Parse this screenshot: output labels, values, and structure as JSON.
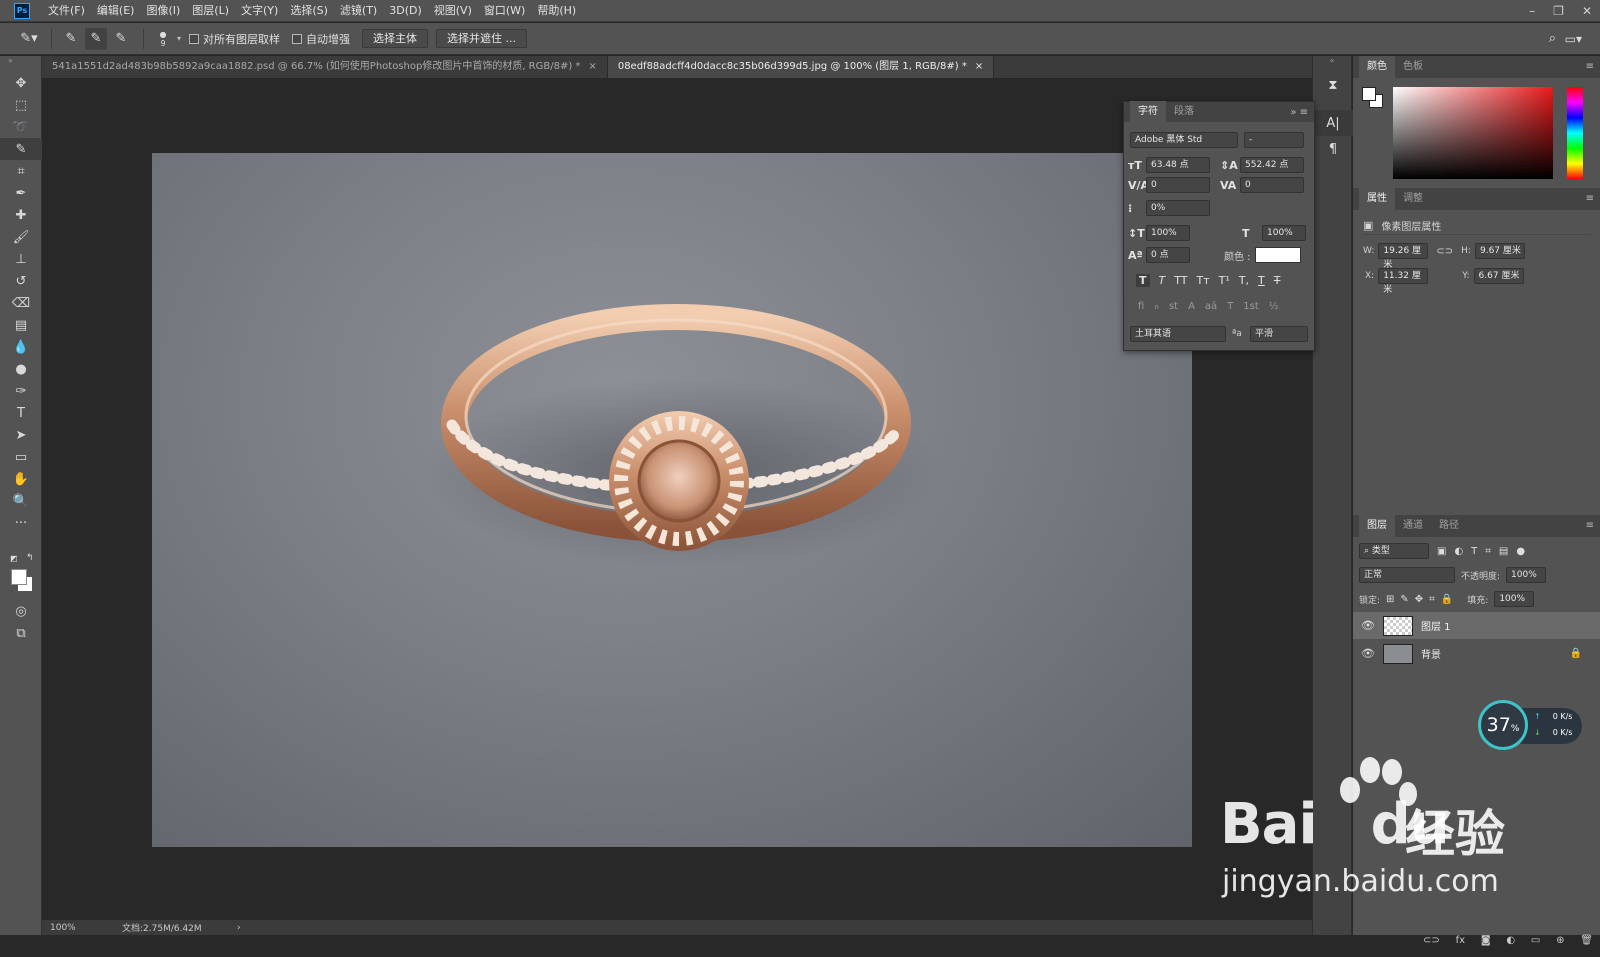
{
  "app": {
    "logo": "Ps",
    "menu": [
      "文件(F)",
      "编辑(E)",
      "图像(I)",
      "图层(L)",
      "文字(Y)",
      "选择(S)",
      "滤镜(T)",
      "3D(D)",
      "视图(V)",
      "窗口(W)",
      "帮助(H)"
    ]
  },
  "options": {
    "brush_size": "9",
    "sample_all_layers": "对所有图层取样",
    "auto_enhance": "自动增强",
    "select_subject": "选择主体",
    "select_and_mask": "选择并遮住 ..."
  },
  "tabs": [
    {
      "label": "541a1551d2ad483b98b5892a9caa1882.psd @ 66.7% (如何使用Photoshop修改图片中首饰的材质, RGB/8#) *",
      "close": "×"
    },
    {
      "label": "08edf88adcff4d0dacc8c35b06d399d5.jpg @ 100% (图层 1, RGB/8#) *",
      "close": "×"
    }
  ],
  "status": {
    "zoom": "100%",
    "doc": "文档:2.75M/6.42M",
    "arrow": "›"
  },
  "character": {
    "tabs": [
      "字符",
      "段落"
    ],
    "font_family": "Adobe 黑体 Std",
    "font_style": "-",
    "size": "63.48 点",
    "leading": "552.42 点",
    "kerning": "0",
    "tracking": "0",
    "tsume": "0%",
    "vscale": "100%",
    "hscale": "100%",
    "baseline": "0 点",
    "color_label": "颜色 :",
    "language": "土耳其语",
    "antialias_icon": "ªa",
    "antialias": "平滑",
    "style_buttons": [
      "T",
      "T",
      "TT",
      "Tт",
      "T¹",
      "T,",
      "T",
      "T"
    ],
    "ot_buttons": [
      "fi",
      "ℴ",
      "st",
      "A",
      "aā",
      "T",
      "1st",
      "½"
    ]
  },
  "color_panel": {
    "tabs": [
      "颜色",
      "色板"
    ]
  },
  "properties": {
    "tabs": [
      "属性",
      "调整"
    ],
    "title": "像素图层属性",
    "w_label": "W:",
    "w": "19.26 厘米",
    "h_label": "H:",
    "h": "9.67 厘米",
    "x_label": "X:",
    "x": "11.32 厘米",
    "y_label": "Y:",
    "y": "6.67 厘米"
  },
  "layers": {
    "tabs": [
      "图层",
      "通道",
      "路径"
    ],
    "filter": "类型",
    "blend": "正常",
    "opacity_label": "不透明度:",
    "opacity": "100%",
    "lock_label": "锁定:",
    "fill_label": "填充:",
    "fill": "100%",
    "items": [
      {
        "name": "图层 1"
      },
      {
        "name": "背景"
      }
    ]
  },
  "widget": {
    "percent": "37",
    "pct_sign": "%",
    "up": "0",
    "down": "0",
    "unit": "K/s"
  },
  "watermark": {
    "brand": "Bai",
    "brand2": "du",
    "cn": "经验",
    "url": "jingyan.baidu.com"
  }
}
